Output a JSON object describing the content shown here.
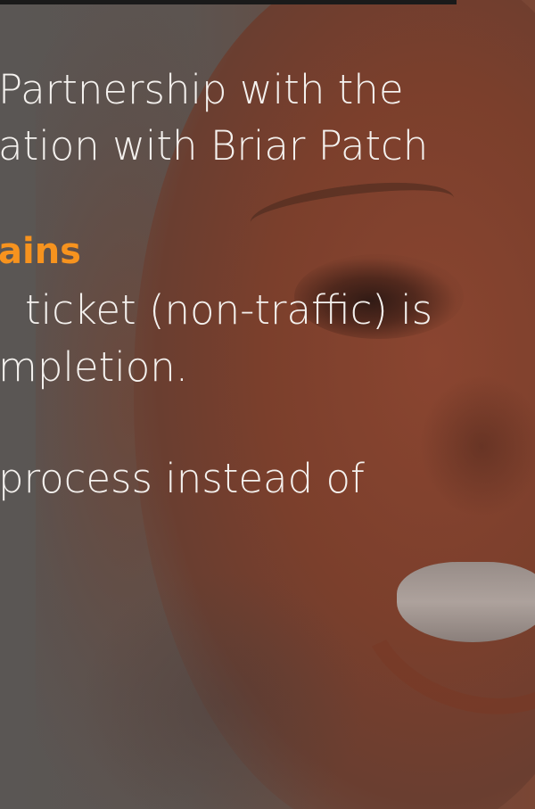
{
  "slide": {
    "lines": [
      "Partnership with the",
      "ation with Briar Patch",
      "ains",
      "ticket (non-traffic) is",
      "mpletion.",
      "process instead of"
    ]
  },
  "colors": {
    "text": "#f4f1ee",
    "accent": "#f7931e",
    "overlay_tint": "#7b3f2c"
  }
}
